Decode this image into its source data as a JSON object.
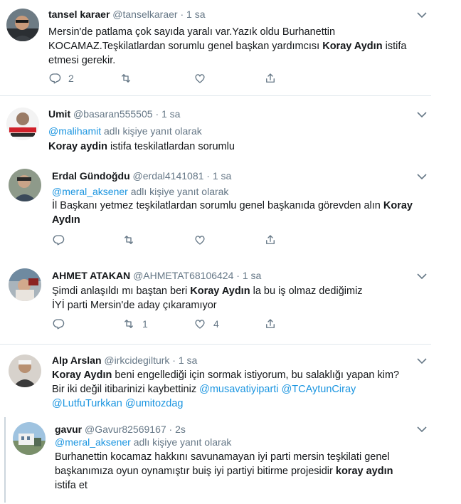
{
  "tweets": [
    {
      "name": "tansel karaer",
      "handle": "@tanselkaraer",
      "dot": "·",
      "time": "1 sa",
      "text_lines": [
        "Mersin'de patlama çok sayıda yaralı var.Yazık oldu Burhanettin",
        "KOCAMAZ.Teşkilatlardan sorumlu genel başkan yardımcısı ",
        "Koray Aydın",
        " istifa",
        "etmesi gerekir."
      ],
      "reply_count": "2",
      "retweet_count": "",
      "like_count": ""
    },
    {
      "name": "Umit",
      "handle": "@basaran555505",
      "dot": "·",
      "time": "1 sa",
      "reply_to_user": "@malihamit",
      "reply_to_suffix": " adlı kişiye yanıt olarak",
      "text_bold": "Koray aydin",
      "text_rest": " istifa teskilatlardan sorumlu"
    },
    {
      "name": "Erdal Gündoğdu",
      "handle": "@erdal4141081",
      "dot": "·",
      "time": "1 sa",
      "reply_to_user": "@meral_aksener",
      "reply_to_suffix": " adlı kişiye yanıt olarak",
      "text_line1": "İl Başkanı yetmez teşkilatlardan sorumlu genel başkanıda görevden alın ",
      "text_bold1": "Koray",
      "text_bold2": "Aydın",
      "reply_count": "",
      "retweet_count": "",
      "like_count": ""
    },
    {
      "name": "AHMET ATAKAN",
      "handle": "@AHMETAT68106424",
      "dot": "·",
      "time": "1 sa",
      "text_pre": "Şimdi anlaşıldı mı baştan beri ",
      "text_bold": "Koray Aydın",
      "text_post": " la bu iş olmaz dediğimiz",
      "text_line2": "İYİ parti Mersin'de aday çıkaramıyor",
      "reply_count": "",
      "retweet_count": "1",
      "like_count": "4"
    },
    {
      "name": "Alp Arslan",
      "handle": "@irkcidegilturk",
      "dot": "·",
      "time": "1 sa",
      "text_bold": "Koray Aydın",
      "text_line1_rest": " beni engellediği için sormak istiyorum, bu salaklığı yapan kim?",
      "text_line2_pre": "Bir iki değil itibarinizi kaybettiniz ",
      "mention1": "@musavatiyiparti",
      "mention2": "@TCAytunCiray",
      "mention3": "@LutfuTurkkan",
      "mention4": "@umitozdag"
    },
    {
      "name": "gavur",
      "handle": "@Gavur82569167",
      "dot": "·",
      "time": "2s",
      "reply_to_user": "@meral_aksener",
      "reply_to_suffix": " adlı kişiye yanıt olarak",
      "text_line1": "Burhanettin kocamaz hakkını savunamayan iyi parti mersin teşkilati genel",
      "text_line2_pre": "başkanımıza oyun oynamıştır buiş iyi partiyi bitirme projesidir ",
      "text_bold": "koray aydın",
      "text_line3": "istifa et"
    }
  ],
  "icons": {
    "reply": "reply-icon",
    "retweet": "retweet-icon",
    "like": "heart-icon",
    "share": "share-icon",
    "caret": "chevron-down-icon"
  },
  "colors": {
    "link": "#1b95e0",
    "secondary": "#657786",
    "divider": "#e1e8ed"
  }
}
